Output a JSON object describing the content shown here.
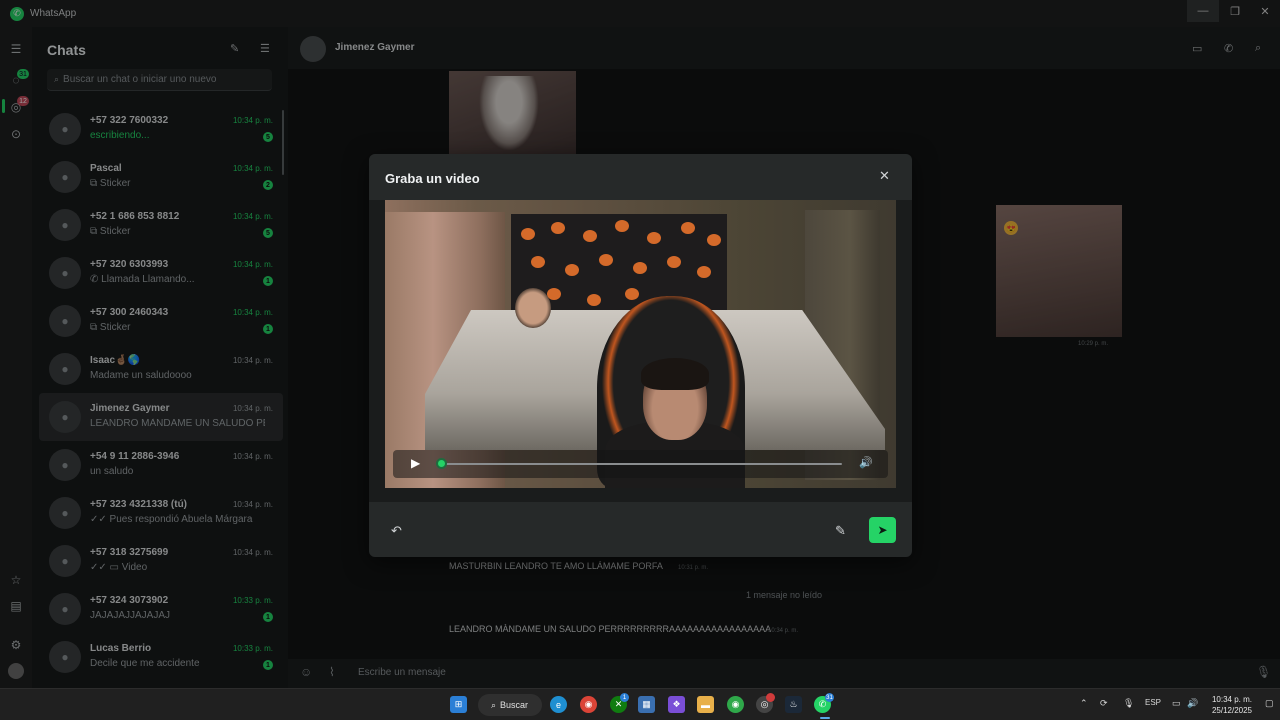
{
  "window": {
    "title": "WhatsApp",
    "controls": [
      "minimize-icon",
      "restore-icon",
      "close-icon"
    ]
  },
  "rail": {
    "icons": [
      "menu-icon",
      "chats-icon",
      "status-icon",
      "channels-icon",
      "starred-icon",
      "archive-icon",
      "settings-icon",
      "profile-avatar"
    ],
    "chats_badge": "31",
    "status_badge": "12"
  },
  "chatlist": {
    "title": "Chats",
    "new_chat_icon": "compose-icon",
    "filter_icon": "filter-icon",
    "search_placeholder": "Buscar un chat o iniciar uno nuevo",
    "items": [
      {
        "name": "+57 322 7600332",
        "time": "10:34 p. m.",
        "preview": "escribiendo...",
        "unread": "5",
        "time_green": true,
        "preview_green": true
      },
      {
        "name": "Pascal",
        "time": "10:34 p. m.",
        "preview": "⧉ Sticker",
        "unread": "2",
        "time_green": true
      },
      {
        "name": "+52 1 686 853 8812",
        "time": "10:34 p. m.",
        "preview": "⧉ Sticker",
        "unread": "5",
        "time_green": true
      },
      {
        "name": "+57 320 6303993",
        "time": "10:34 p. m.",
        "preview": "✆ Llamada Llamando...",
        "unread": "1",
        "time_green": true
      },
      {
        "name": "+57 300 2460343",
        "time": "10:34 p. m.",
        "preview": "⧉ Sticker",
        "unread": "1",
        "time_green": true
      },
      {
        "name": "Isaac🤞🏽🌎",
        "time": "10:34 p. m.",
        "preview": "Madame un saludoooo"
      },
      {
        "name": "Jimenez Gaymer",
        "time": "10:34 p. m.",
        "preview": "LEANDRO MÀNDAME UN SALUDO PER..."
      },
      {
        "name": "+54 9 11 2886-3946",
        "time": "10:34 p. m.",
        "preview": "un saludo"
      },
      {
        "name": "+57 323 4321338 (tú)",
        "time": "10:34 p. m.",
        "preview": "✓✓ Pues respondió Abuela Márgara"
      },
      {
        "name": "+57 318 3275699",
        "time": "10:34 p. m.",
        "preview": "✓✓ ▭ Video"
      },
      {
        "name": "+57 324 3073902",
        "time": "10:33 p. m.",
        "preview": "JAJAJAJJAJAJAJ",
        "unread": "1",
        "time_green": true
      },
      {
        "name": "Lucas Berrio",
        "time": "10:33 p. m.",
        "preview": "Decile que me accidente",
        "unread": "1",
        "time_green": true
      }
    ]
  },
  "conversation": {
    "contact_name": "Jimenez Gaymer",
    "header_icons": [
      "video-call-icon",
      "voice-call-icon",
      "search-icon"
    ],
    "image_right_time": "10:29 p. m.",
    "msg1_text": "MASTURBIN LEANDRO TE AMO LLÁMAME PORFA",
    "msg1_time": "10:31 p. m.",
    "unread_separator": "1 mensaje no leído",
    "msg2_text": "LEANDRO MÀNDAME UN SALUDO PERRRRRRRRRAAAAAAAAAAAAAAAAA",
    "msg2_time": "10:34 p. m.",
    "composer_placeholder": "Escribe un mensaje"
  },
  "modal": {
    "title": "Graba un video",
    "close_icon": "close-icon",
    "player": {
      "play_icon": "play-icon",
      "volume_icon": "volume-icon",
      "progress": 0.0
    },
    "footer": {
      "retake_icon": "undo-icon",
      "edit_icon": "pencil-icon",
      "send_icon": "send-icon"
    },
    "accent_color": "#25d366"
  },
  "taskbar": {
    "search_label": "Buscar",
    "language": "ESP",
    "time": "10:34 p. m.",
    "date": "25/12/2025",
    "whatsapp_badge": "31"
  }
}
